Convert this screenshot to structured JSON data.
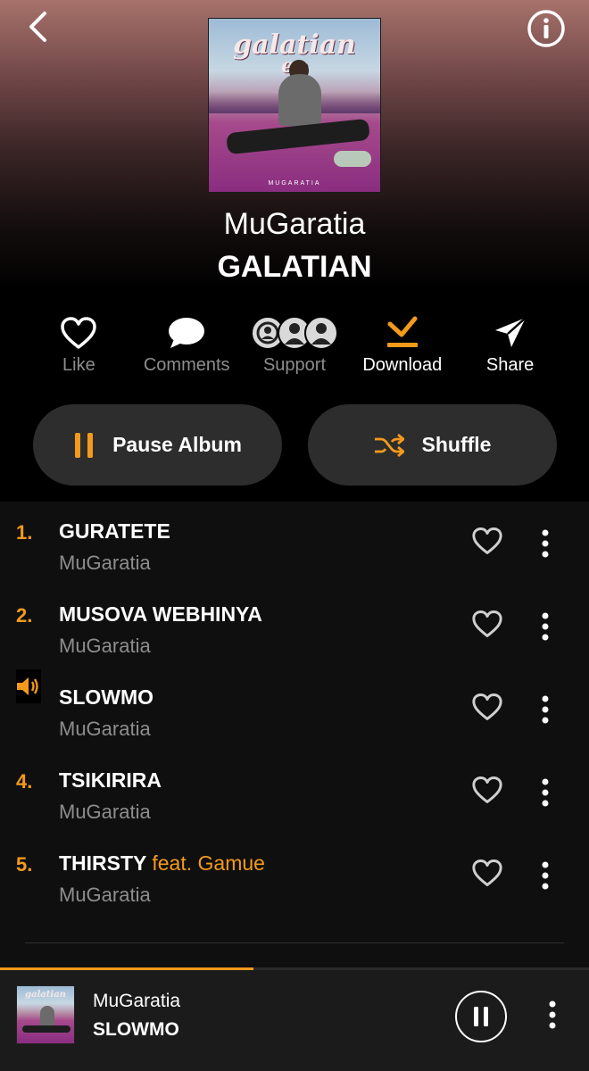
{
  "colors": {
    "accent": "#f49a1a",
    "muted": "#8d8d8d",
    "pill": "#2d2d2d"
  },
  "nav": {
    "back_icon": "chevron-left-icon",
    "info_icon": "info-icon"
  },
  "album": {
    "cover_title_line1": "galatian",
    "cover_title_line2": "ep",
    "cover_label": "MUGARATIA",
    "artist": "MuGaratia",
    "title": "GALATIAN"
  },
  "actions": [
    {
      "label": "Like",
      "icon": "heart-outline-icon"
    },
    {
      "label": "Comments",
      "icon": "speech-bubble-icon"
    },
    {
      "label": "Support",
      "icon": "supporters-avatars-icon"
    },
    {
      "label": "Download",
      "icon": "download-check-icon"
    },
    {
      "label": "Share",
      "icon": "send-arrow-icon"
    }
  ],
  "buttons": {
    "pause_album": "Pause Album",
    "shuffle": "Shuffle"
  },
  "tracks": [
    {
      "number": "1.",
      "title": "GURATETE",
      "feat": "",
      "artist": "MuGaratia",
      "playing": false
    },
    {
      "number": "2.",
      "title": "MUSOVA WEBHINYA",
      "feat": "",
      "artist": "MuGaratia",
      "playing": false
    },
    {
      "number": "",
      "title": "SLOWMO",
      "feat": "",
      "artist": "MuGaratia",
      "playing": true
    },
    {
      "number": "4.",
      "title": "TSIKIRIRA",
      "feat": "",
      "artist": "MuGaratia",
      "playing": false
    },
    {
      "number": "5.",
      "title": "THIRSTY",
      "feat": "feat. Gamue",
      "artist": "MuGaratia",
      "playing": false
    }
  ],
  "now_playing": {
    "artist": "MuGaratia",
    "title": "SLOWMO",
    "progress": 0.43
  }
}
